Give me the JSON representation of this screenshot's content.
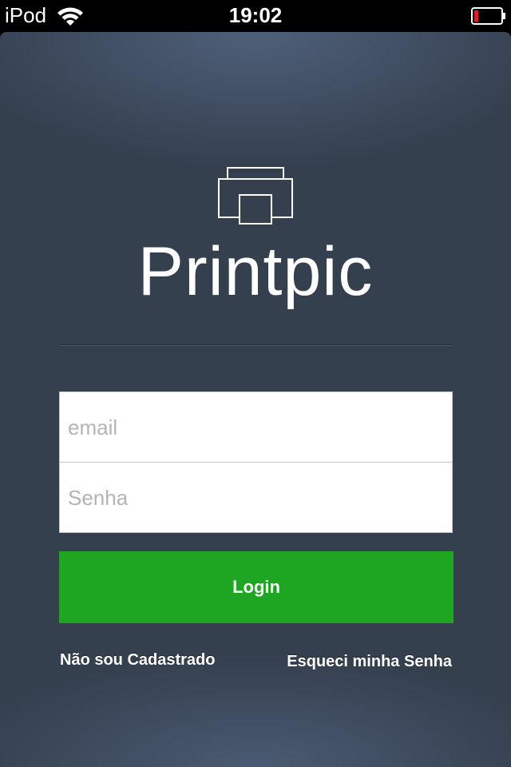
{
  "status_bar": {
    "device": "iPod",
    "time": "19:02",
    "wifi_icon": "wifi-icon",
    "battery_icon": "battery-low-icon",
    "battery_color": "#e02020"
  },
  "app": {
    "title": "Printpic",
    "logo_icon": "printer-icon"
  },
  "form": {
    "email_placeholder": "email",
    "email_value": "",
    "password_placeholder": "Senha",
    "password_value": ""
  },
  "actions": {
    "login_label": "Login",
    "signup_link": "Não sou Cadastrado",
    "forgot_link": "Esqueci minha Senha"
  },
  "colors": {
    "background": "#35404f",
    "login_button": "#1ea521",
    "text": "#ffffff"
  }
}
